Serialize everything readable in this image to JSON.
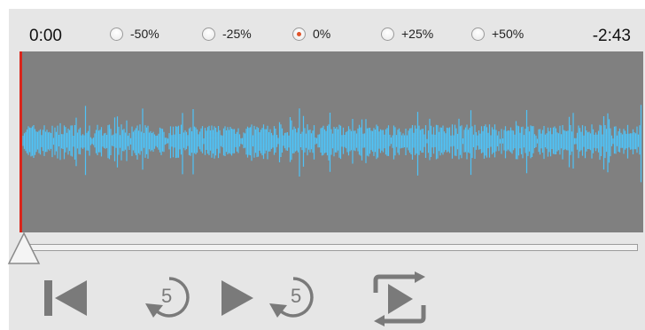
{
  "time": {
    "current": "0:00",
    "remaining": "-2:43"
  },
  "speed": {
    "options": [
      {
        "label": "-50%",
        "selected": false
      },
      {
        "label": "-25%",
        "selected": false
      },
      {
        "label": "0%",
        "selected": true
      },
      {
        "label": "+25%",
        "selected": false
      },
      {
        "label": "+50%",
        "selected": false
      }
    ]
  },
  "playback": {
    "position_fraction": 0.0
  },
  "controls": {
    "skip_back_seconds": "5",
    "skip_forward_seconds": "5",
    "icons": [
      "skip-to-start-icon",
      "rewind-5-icon",
      "play-icon",
      "forward-5-icon",
      "loop-play-icon"
    ]
  },
  "colors": {
    "panel": "#e6e6e6",
    "waveform_bg": "#808080",
    "waveform": "#4fc3f7",
    "playhead": "#d9261c",
    "radio_selected": "#e0542a",
    "icon": "#7a7a7a"
  }
}
